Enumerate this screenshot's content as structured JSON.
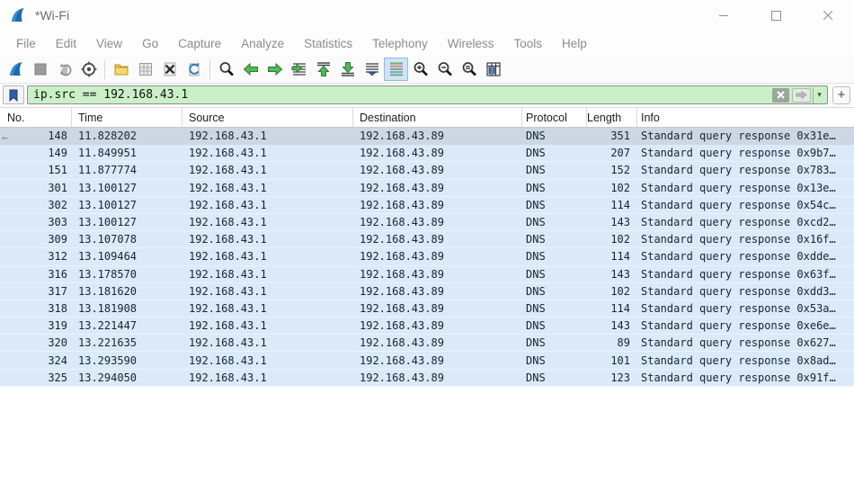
{
  "window": {
    "title": "*Wi-Fi",
    "controls": {
      "minimize": "minimize",
      "maximize": "maximize",
      "close": "close"
    }
  },
  "colors": {
    "filter_valid_bg": "#c9f0c6",
    "row_dns_bg": "#dbe9f8",
    "row_selected_bg": "#ccd7e3",
    "row_text": "#12272e",
    "accent_blue": "#1c6bb0",
    "nav_green": "#45b049"
  },
  "menu": {
    "items": [
      "File",
      "Edit",
      "View",
      "Go",
      "Capture",
      "Analyze",
      "Statistics",
      "Telephony",
      "Wireless",
      "Tools",
      "Help"
    ]
  },
  "toolbar": {
    "icons": [
      "start-capture-icon",
      "stop-capture-icon",
      "restart-capture-icon",
      "capture-options-icon",
      "open-file-icon",
      "save-file-icon",
      "close-file-icon",
      "reload-icon",
      "find-packet-icon",
      "go-back-icon",
      "go-forward-icon",
      "go-to-packet-icon",
      "go-top-icon",
      "go-bottom-icon",
      "auto-scroll-icon",
      "colorize-icon",
      "zoom-in-icon",
      "zoom-out-icon",
      "zoom-original-icon",
      "resize-columns-icon"
    ]
  },
  "filter": {
    "value": "ip.src == 192.168.43.1",
    "add_label": "+",
    "caret": "▾"
  },
  "table": {
    "columns": [
      "No.",
      "Time",
      "Source",
      "Destination",
      "Protocol",
      "Length",
      "Info"
    ],
    "rows": [
      {
        "no": "148",
        "time": "11.828202",
        "src": "192.168.43.1",
        "dst": "192.168.43.89",
        "proto": "DNS",
        "len": "351",
        "info": "Standard query response 0x31e…",
        "selected": true,
        "marker": "←"
      },
      {
        "no": "149",
        "time": "11.849951",
        "src": "192.168.43.1",
        "dst": "192.168.43.89",
        "proto": "DNS",
        "len": "207",
        "info": "Standard query response 0x9b7…",
        "selected": false,
        "marker": ""
      },
      {
        "no": "151",
        "time": "11.877774",
        "src": "192.168.43.1",
        "dst": "192.168.43.89",
        "proto": "DNS",
        "len": "152",
        "info": "Standard query response 0x783…",
        "selected": false,
        "marker": ""
      },
      {
        "no": "301",
        "time": "13.100127",
        "src": "192.168.43.1",
        "dst": "192.168.43.89",
        "proto": "DNS",
        "len": "102",
        "info": "Standard query response 0x13e…",
        "selected": false,
        "marker": ""
      },
      {
        "no": "302",
        "time": "13.100127",
        "src": "192.168.43.1",
        "dst": "192.168.43.89",
        "proto": "DNS",
        "len": "114",
        "info": "Standard query response 0x54c…",
        "selected": false,
        "marker": ""
      },
      {
        "no": "303",
        "time": "13.100127",
        "src": "192.168.43.1",
        "dst": "192.168.43.89",
        "proto": "DNS",
        "len": "143",
        "info": "Standard query response 0xcd2…",
        "selected": false,
        "marker": ""
      },
      {
        "no": "309",
        "time": "13.107078",
        "src": "192.168.43.1",
        "dst": "192.168.43.89",
        "proto": "DNS",
        "len": "102",
        "info": "Standard query response 0x16f…",
        "selected": false,
        "marker": ""
      },
      {
        "no": "312",
        "time": "13.109464",
        "src": "192.168.43.1",
        "dst": "192.168.43.89",
        "proto": "DNS",
        "len": "114",
        "info": "Standard query response 0xdde…",
        "selected": false,
        "marker": ""
      },
      {
        "no": "316",
        "time": "13.178570",
        "src": "192.168.43.1",
        "dst": "192.168.43.89",
        "proto": "DNS",
        "len": "143",
        "info": "Standard query response 0x63f…",
        "selected": false,
        "marker": ""
      },
      {
        "no": "317",
        "time": "13.181620",
        "src": "192.168.43.1",
        "dst": "192.168.43.89",
        "proto": "DNS",
        "len": "102",
        "info": "Standard query response 0xdd3…",
        "selected": false,
        "marker": ""
      },
      {
        "no": "318",
        "time": "13.181908",
        "src": "192.168.43.1",
        "dst": "192.168.43.89",
        "proto": "DNS",
        "len": "114",
        "info": "Standard query response 0x53a…",
        "selected": false,
        "marker": ""
      },
      {
        "no": "319",
        "time": "13.221447",
        "src": "192.168.43.1",
        "dst": "192.168.43.89",
        "proto": "DNS",
        "len": "143",
        "info": "Standard query response 0xe6e…",
        "selected": false,
        "marker": ""
      },
      {
        "no": "320",
        "time": "13.221635",
        "src": "192.168.43.1",
        "dst": "192.168.43.89",
        "proto": "DNS",
        "len": "89",
        "info": "Standard query response 0x627…",
        "selected": false,
        "marker": ""
      },
      {
        "no": "324",
        "time": "13.293590",
        "src": "192.168.43.1",
        "dst": "192.168.43.89",
        "proto": "DNS",
        "len": "101",
        "info": "Standard query response 0x8ad…",
        "selected": false,
        "marker": ""
      },
      {
        "no": "325",
        "time": "13.294050",
        "src": "192.168.43.1",
        "dst": "192.168.43.89",
        "proto": "DNS",
        "len": "123",
        "info": "Standard query response 0x91f…",
        "selected": false,
        "marker": ""
      }
    ]
  }
}
